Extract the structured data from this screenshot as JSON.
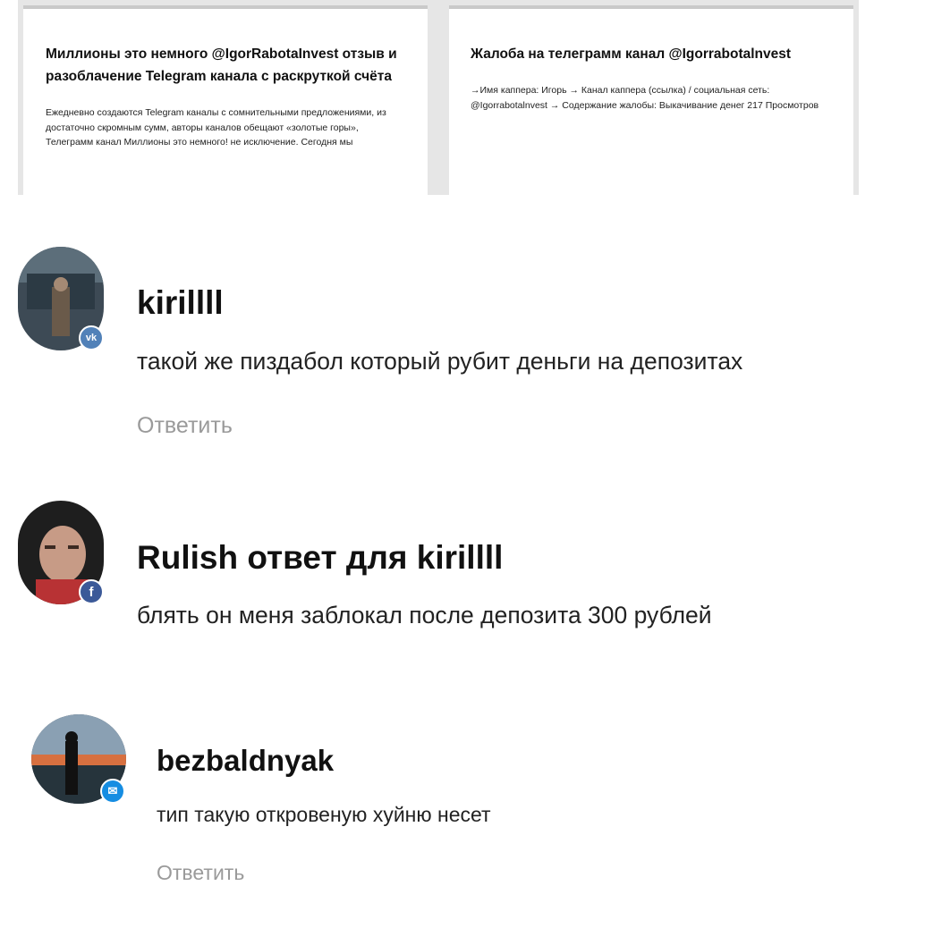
{
  "cards": [
    {
      "title": "Миллионы это немного @IgorRabotaInvest отзыв и разоблачение Telegram канала с раскруткой счёта",
      "excerpt": "Ежедневно создаются Telegram каналы с сомнительными предложениями, из достаточно скромным сумм, авторы каналов обещают «золотые горы», Телеграмм канал Миллионы это немного! не исключение. Сегодня мы"
    },
    {
      "title": "Жалоба на телеграмм канал @Igorrabotalnvest",
      "excerpt": "→Имя каппера: Игорь → Канал каппера (ссылка) / социальная сеть: @Igorrabotalnvest → Содержание жалобы: Выкачивание денег 217 Просмотров"
    }
  ],
  "comments": [
    {
      "author": "kirillll",
      "text": "такой же пиздабол который рубит деньги на депозитах",
      "reply_label": "Ответить",
      "badge_icon": "vk-icon",
      "badge_text": "vk",
      "badge_color": "#5181b8"
    },
    {
      "author": "Rulish ответ для kirillll",
      "text": "блять он меня заблокал после депозита 300 рублей",
      "badge_icon": "facebook-icon",
      "badge_text": "f",
      "badge_color": "#3b5998"
    },
    {
      "author": "bezbaldnyak",
      "text": "тип такую откровеную хуйню несет",
      "reply_label": "Ответить",
      "badge_icon": "mail-icon",
      "badge_text": "✉",
      "badge_color": "#168de2"
    }
  ]
}
